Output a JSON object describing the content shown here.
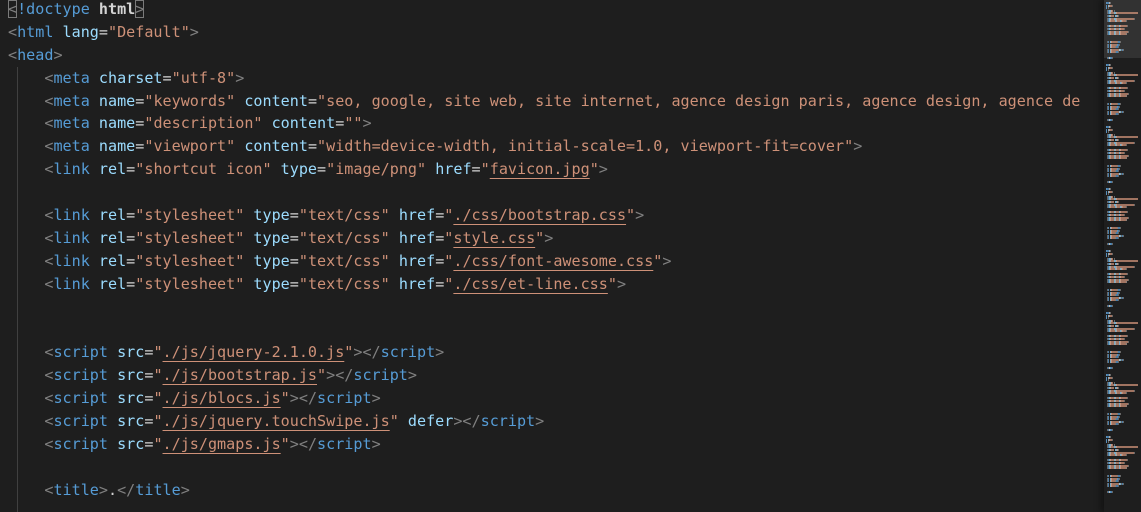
{
  "editor": {
    "lines": [
      [
        {
          "t": "<",
          "c": "t-br match"
        },
        {
          "t": "!doctype",
          "c": "t-tag"
        },
        {
          "t": " ",
          "c": "t-text"
        },
        {
          "t": "html",
          "c": "t-bold"
        },
        {
          "t": ">",
          "c": "t-br match"
        }
      ],
      [
        {
          "t": "<",
          "c": "t-br"
        },
        {
          "t": "html",
          "c": "t-tag"
        },
        {
          "t": " ",
          "c": "t-text"
        },
        {
          "t": "lang",
          "c": "t-attr"
        },
        {
          "t": "=",
          "c": "t-eq"
        },
        {
          "t": "\"Default\"",
          "c": "t-str"
        },
        {
          "t": ">",
          "c": "t-br"
        }
      ],
      [
        {
          "t": "<",
          "c": "t-br"
        },
        {
          "t": "head",
          "c": "t-tag"
        },
        {
          "t": ">",
          "c": "t-br"
        }
      ],
      [
        {
          "t": "    ",
          "c": "t-text",
          "guide": true
        },
        {
          "t": "<",
          "c": "t-br"
        },
        {
          "t": "meta",
          "c": "t-tag"
        },
        {
          "t": " ",
          "c": "t-text"
        },
        {
          "t": "charset",
          "c": "t-attr"
        },
        {
          "t": "=",
          "c": "t-eq"
        },
        {
          "t": "\"utf-8\"",
          "c": "t-str"
        },
        {
          "t": ">",
          "c": "t-br"
        }
      ],
      [
        {
          "t": "    ",
          "c": "t-text",
          "guide": true
        },
        {
          "t": "<",
          "c": "t-br"
        },
        {
          "t": "meta",
          "c": "t-tag"
        },
        {
          "t": " ",
          "c": "t-text"
        },
        {
          "t": "name",
          "c": "t-attr"
        },
        {
          "t": "=",
          "c": "t-eq"
        },
        {
          "t": "\"keywords\"",
          "c": "t-str"
        },
        {
          "t": " ",
          "c": "t-text"
        },
        {
          "t": "content",
          "c": "t-attr"
        },
        {
          "t": "=",
          "c": "t-eq"
        },
        {
          "t": "\"seo, google, site web, site internet, agence design paris, agence design, agence de",
          "c": "t-str"
        }
      ],
      [
        {
          "t": "    ",
          "c": "t-text",
          "guide": true
        },
        {
          "t": "<",
          "c": "t-br"
        },
        {
          "t": "meta",
          "c": "t-tag"
        },
        {
          "t": " ",
          "c": "t-text"
        },
        {
          "t": "name",
          "c": "t-attr"
        },
        {
          "t": "=",
          "c": "t-eq"
        },
        {
          "t": "\"description\"",
          "c": "t-str"
        },
        {
          "t": " ",
          "c": "t-text"
        },
        {
          "t": "content",
          "c": "t-attr"
        },
        {
          "t": "=",
          "c": "t-eq"
        },
        {
          "t": "\"\"",
          "c": "t-str"
        },
        {
          "t": ">",
          "c": "t-br"
        }
      ],
      [
        {
          "t": "    ",
          "c": "t-text",
          "guide": true
        },
        {
          "t": "<",
          "c": "t-br"
        },
        {
          "t": "meta",
          "c": "t-tag"
        },
        {
          "t": " ",
          "c": "t-text"
        },
        {
          "t": "name",
          "c": "t-attr"
        },
        {
          "t": "=",
          "c": "t-eq"
        },
        {
          "t": "\"viewport\"",
          "c": "t-str"
        },
        {
          "t": " ",
          "c": "t-text"
        },
        {
          "t": "content",
          "c": "t-attr"
        },
        {
          "t": "=",
          "c": "t-eq"
        },
        {
          "t": "\"width=device-width, initial-scale=1.0, viewport-fit=cover\"",
          "c": "t-str"
        },
        {
          "t": ">",
          "c": "t-br"
        }
      ],
      [
        {
          "t": "    ",
          "c": "t-text",
          "guide": true
        },
        {
          "t": "<",
          "c": "t-br"
        },
        {
          "t": "link",
          "c": "t-tag"
        },
        {
          "t": " ",
          "c": "t-text"
        },
        {
          "t": "rel",
          "c": "t-attr"
        },
        {
          "t": "=",
          "c": "t-eq"
        },
        {
          "t": "\"shortcut icon\"",
          "c": "t-str"
        },
        {
          "t": " ",
          "c": "t-text"
        },
        {
          "t": "type",
          "c": "t-attr"
        },
        {
          "t": "=",
          "c": "t-eq"
        },
        {
          "t": "\"image/png\"",
          "c": "t-str"
        },
        {
          "t": " ",
          "c": "t-text"
        },
        {
          "t": "href",
          "c": "t-attr"
        },
        {
          "t": "=",
          "c": "t-eq"
        },
        {
          "t": "\"",
          "c": "t-str"
        },
        {
          "t": "favicon.jpg",
          "c": "t-link",
          "link": true
        },
        {
          "t": "\"",
          "c": "t-str"
        },
        {
          "t": ">",
          "c": "t-br"
        }
      ],
      [
        {
          "t": "    ",
          "c": "t-text",
          "guide": true
        }
      ],
      [
        {
          "t": "    ",
          "c": "t-text",
          "guide": true
        },
        {
          "t": "<",
          "c": "t-br"
        },
        {
          "t": "link",
          "c": "t-tag"
        },
        {
          "t": " ",
          "c": "t-text"
        },
        {
          "t": "rel",
          "c": "t-attr"
        },
        {
          "t": "=",
          "c": "t-eq"
        },
        {
          "t": "\"stylesheet\"",
          "c": "t-str"
        },
        {
          "t": " ",
          "c": "t-text"
        },
        {
          "t": "type",
          "c": "t-attr"
        },
        {
          "t": "=",
          "c": "t-eq"
        },
        {
          "t": "\"text/css\"",
          "c": "t-str"
        },
        {
          "t": " ",
          "c": "t-text"
        },
        {
          "t": "href",
          "c": "t-attr"
        },
        {
          "t": "=",
          "c": "t-eq"
        },
        {
          "t": "\"",
          "c": "t-str"
        },
        {
          "t": "./css/bootstrap.css",
          "c": "t-link",
          "link": true
        },
        {
          "t": "\"",
          "c": "t-str"
        },
        {
          "t": ">",
          "c": "t-br"
        }
      ],
      [
        {
          "t": "    ",
          "c": "t-text",
          "guide": true
        },
        {
          "t": "<",
          "c": "t-br"
        },
        {
          "t": "link",
          "c": "t-tag"
        },
        {
          "t": " ",
          "c": "t-text"
        },
        {
          "t": "rel",
          "c": "t-attr"
        },
        {
          "t": "=",
          "c": "t-eq"
        },
        {
          "t": "\"stylesheet\"",
          "c": "t-str"
        },
        {
          "t": " ",
          "c": "t-text"
        },
        {
          "t": "type",
          "c": "t-attr"
        },
        {
          "t": "=",
          "c": "t-eq"
        },
        {
          "t": "\"text/css\"",
          "c": "t-str"
        },
        {
          "t": " ",
          "c": "t-text"
        },
        {
          "t": "href",
          "c": "t-attr"
        },
        {
          "t": "=",
          "c": "t-eq"
        },
        {
          "t": "\"",
          "c": "t-str"
        },
        {
          "t": "style.css",
          "c": "t-link",
          "link": true
        },
        {
          "t": "\"",
          "c": "t-str"
        },
        {
          "t": ">",
          "c": "t-br"
        }
      ],
      [
        {
          "t": "    ",
          "c": "t-text",
          "guide": true
        },
        {
          "t": "<",
          "c": "t-br"
        },
        {
          "t": "link",
          "c": "t-tag"
        },
        {
          "t": " ",
          "c": "t-text"
        },
        {
          "t": "rel",
          "c": "t-attr"
        },
        {
          "t": "=",
          "c": "t-eq"
        },
        {
          "t": "\"stylesheet\"",
          "c": "t-str"
        },
        {
          "t": " ",
          "c": "t-text"
        },
        {
          "t": "type",
          "c": "t-attr"
        },
        {
          "t": "=",
          "c": "t-eq"
        },
        {
          "t": "\"text/css\"",
          "c": "t-str"
        },
        {
          "t": " ",
          "c": "t-text"
        },
        {
          "t": "href",
          "c": "t-attr"
        },
        {
          "t": "=",
          "c": "t-eq"
        },
        {
          "t": "\"",
          "c": "t-str"
        },
        {
          "t": "./css/font-awesome.css",
          "c": "t-link",
          "link": true
        },
        {
          "t": "\"",
          "c": "t-str"
        },
        {
          "t": ">",
          "c": "t-br"
        }
      ],
      [
        {
          "t": "    ",
          "c": "t-text",
          "guide": true
        },
        {
          "t": "<",
          "c": "t-br"
        },
        {
          "t": "link",
          "c": "t-tag"
        },
        {
          "t": " ",
          "c": "t-text"
        },
        {
          "t": "rel",
          "c": "t-attr"
        },
        {
          "t": "=",
          "c": "t-eq"
        },
        {
          "t": "\"stylesheet\"",
          "c": "t-str"
        },
        {
          "t": " ",
          "c": "t-text"
        },
        {
          "t": "type",
          "c": "t-attr"
        },
        {
          "t": "=",
          "c": "t-eq"
        },
        {
          "t": "\"text/css\"",
          "c": "t-str"
        },
        {
          "t": " ",
          "c": "t-text"
        },
        {
          "t": "href",
          "c": "t-attr"
        },
        {
          "t": "=",
          "c": "t-eq"
        },
        {
          "t": "\"",
          "c": "t-str"
        },
        {
          "t": "./css/et-line.css",
          "c": "t-link",
          "link": true
        },
        {
          "t": "\"",
          "c": "t-str"
        },
        {
          "t": ">",
          "c": "t-br"
        }
      ],
      [
        {
          "t": "    ",
          "c": "t-text",
          "guide": true
        }
      ],
      [
        {
          "t": "    ",
          "c": "t-text",
          "guide": true
        }
      ],
      [
        {
          "t": "    ",
          "c": "t-text",
          "guide": true
        },
        {
          "t": "<",
          "c": "t-br"
        },
        {
          "t": "script",
          "c": "t-tag"
        },
        {
          "t": " ",
          "c": "t-text"
        },
        {
          "t": "src",
          "c": "t-attr"
        },
        {
          "t": "=",
          "c": "t-eq"
        },
        {
          "t": "\"",
          "c": "t-str"
        },
        {
          "t": "./js/jquery-2.1.0.js",
          "c": "t-link",
          "link": true
        },
        {
          "t": "\"",
          "c": "t-str"
        },
        {
          "t": "></",
          "c": "t-br"
        },
        {
          "t": "script",
          "c": "t-tag"
        },
        {
          "t": ">",
          "c": "t-br"
        }
      ],
      [
        {
          "t": "    ",
          "c": "t-text",
          "guide": true
        },
        {
          "t": "<",
          "c": "t-br"
        },
        {
          "t": "script",
          "c": "t-tag"
        },
        {
          "t": " ",
          "c": "t-text"
        },
        {
          "t": "src",
          "c": "t-attr"
        },
        {
          "t": "=",
          "c": "t-eq"
        },
        {
          "t": "\"",
          "c": "t-str"
        },
        {
          "t": "./js/bootstrap.js",
          "c": "t-link",
          "link": true
        },
        {
          "t": "\"",
          "c": "t-str"
        },
        {
          "t": "></",
          "c": "t-br"
        },
        {
          "t": "script",
          "c": "t-tag"
        },
        {
          "t": ">",
          "c": "t-br"
        }
      ],
      [
        {
          "t": "    ",
          "c": "t-text",
          "guide": true
        },
        {
          "t": "<",
          "c": "t-br"
        },
        {
          "t": "script",
          "c": "t-tag"
        },
        {
          "t": " ",
          "c": "t-text"
        },
        {
          "t": "src",
          "c": "t-attr"
        },
        {
          "t": "=",
          "c": "t-eq"
        },
        {
          "t": "\"",
          "c": "t-str"
        },
        {
          "t": "./js/blocs.js",
          "c": "t-link",
          "link": true
        },
        {
          "t": "\"",
          "c": "t-str"
        },
        {
          "t": "></",
          "c": "t-br"
        },
        {
          "t": "script",
          "c": "t-tag"
        },
        {
          "t": ">",
          "c": "t-br"
        }
      ],
      [
        {
          "t": "    ",
          "c": "t-text",
          "guide": true
        },
        {
          "t": "<",
          "c": "t-br"
        },
        {
          "t": "script",
          "c": "t-tag"
        },
        {
          "t": " ",
          "c": "t-text"
        },
        {
          "t": "src",
          "c": "t-attr"
        },
        {
          "t": "=",
          "c": "t-eq"
        },
        {
          "t": "\"",
          "c": "t-str"
        },
        {
          "t": "./js/jquery.touchSwipe.js",
          "c": "t-link",
          "link": true
        },
        {
          "t": "\"",
          "c": "t-str"
        },
        {
          "t": " ",
          "c": "t-text"
        },
        {
          "t": "defer",
          "c": "t-attr"
        },
        {
          "t": "></",
          "c": "t-br"
        },
        {
          "t": "script",
          "c": "t-tag"
        },
        {
          "t": ">",
          "c": "t-br"
        }
      ],
      [
        {
          "t": "    ",
          "c": "t-text",
          "guide": true
        },
        {
          "t": "<",
          "c": "t-br"
        },
        {
          "t": "script",
          "c": "t-tag"
        },
        {
          "t": " ",
          "c": "t-text"
        },
        {
          "t": "src",
          "c": "t-attr"
        },
        {
          "t": "=",
          "c": "t-eq"
        },
        {
          "t": "\"",
          "c": "t-str"
        },
        {
          "t": "./js/gmaps.js",
          "c": "t-link",
          "link": true
        },
        {
          "t": "\"",
          "c": "t-str"
        },
        {
          "t": "></",
          "c": "t-br"
        },
        {
          "t": "script",
          "c": "t-tag"
        },
        {
          "t": ">",
          "c": "t-br"
        }
      ],
      [
        {
          "t": "    ",
          "c": "t-text",
          "guide": true
        }
      ],
      [
        {
          "t": "    ",
          "c": "t-text",
          "guide": true
        },
        {
          "t": "<",
          "c": "t-br"
        },
        {
          "t": "title",
          "c": "t-tag"
        },
        {
          "t": ">",
          "c": "t-br"
        },
        {
          "t": ".",
          "c": "t-text"
        },
        {
          "t": "</",
          "c": "t-br"
        },
        {
          "t": "title",
          "c": "t-tag"
        },
        {
          "t": ">",
          "c": "t-br"
        }
      ],
      [
        {
          "t": "    ",
          "c": "t-text",
          "guide": true
        }
      ]
    ]
  },
  "colors": {
    "background": "#1e1e1e",
    "tag": "#569cd6",
    "attribute": "#9cdcfe",
    "string": "#ce9178",
    "bracket": "#808080",
    "text": "#d4d4d4",
    "indent_guide": "#404040"
  }
}
